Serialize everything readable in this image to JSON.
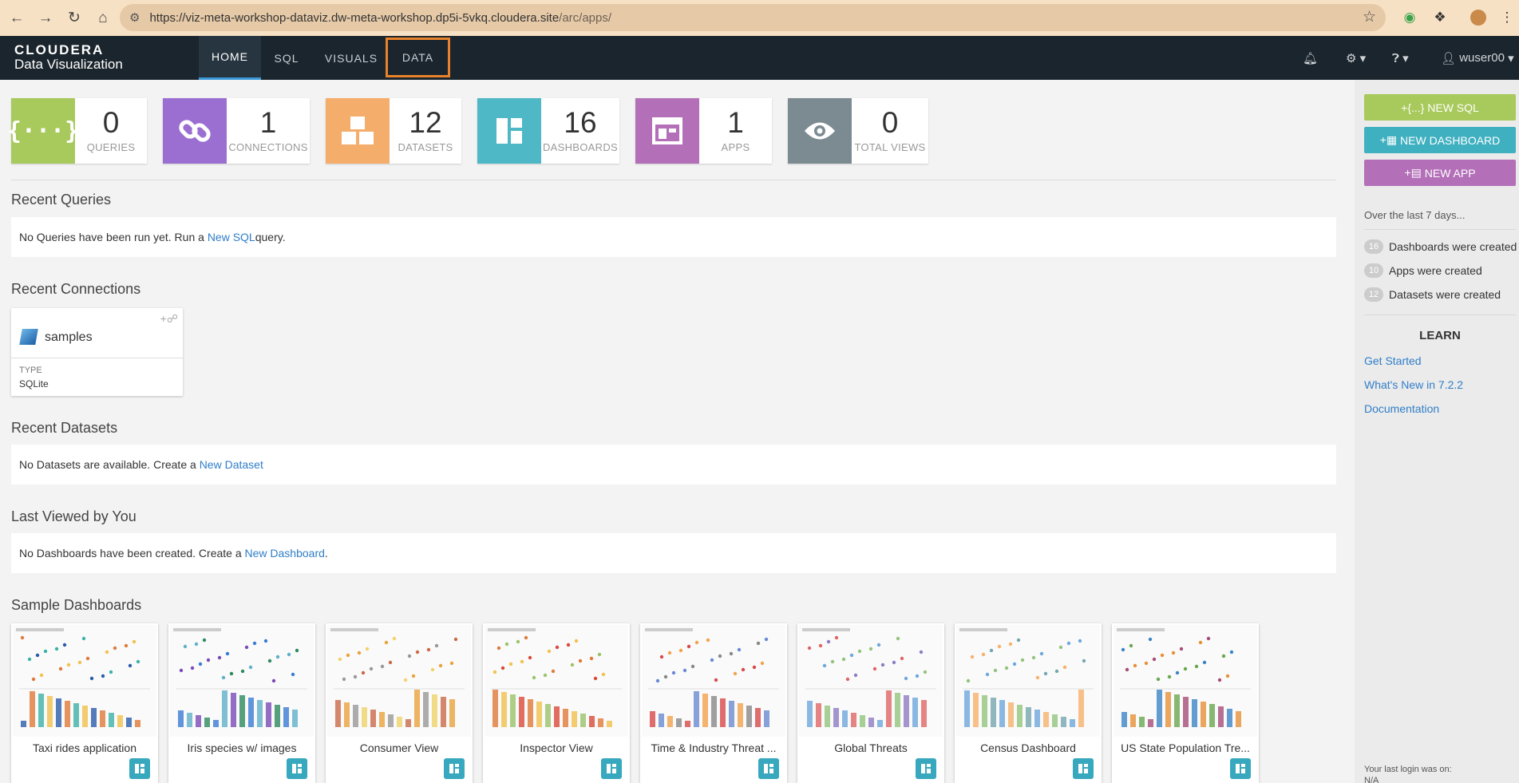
{
  "browser": {
    "url_main": "https://viz-meta-workshop-dataviz.dw-meta-workshop.dp5i-5vkq.cloudera.site",
    "url_path": "/arc/apps/"
  },
  "app": {
    "logo_top": "CLOUDERA",
    "logo_bottom": "Data Visualization"
  },
  "nav": {
    "tabs": [
      "HOME",
      "SQL",
      "VISUALS",
      "DATA"
    ],
    "user": "wuser00"
  },
  "stats": [
    {
      "value": "0",
      "label": "QUERIES",
      "color": "#a8c95b"
    },
    {
      "value": "1",
      "label": "CONNECTIONS",
      "color": "#9b6fd1"
    },
    {
      "value": "12",
      "label": "DATASETS",
      "color": "#f5ad6b"
    },
    {
      "value": "16",
      "label": "DASHBOARDS",
      "color": "#4fb8c6"
    },
    {
      "value": "1",
      "label": "APPS",
      "color": "#b36fb8"
    },
    {
      "value": "0",
      "label": "TOTAL VIEWS",
      "color": "#7c8a92"
    }
  ],
  "sections": {
    "recent_queries": {
      "title": "Recent Queries",
      "msg_pre": "No Queries have been run yet. Run a ",
      "link": "New SQL",
      "msg_post": " query."
    },
    "recent_connections": {
      "title": "Recent Connections"
    },
    "recent_datasets": {
      "title": "Recent Datasets",
      "msg_pre": "No Datasets are available. Create a ",
      "link": "New Dataset"
    },
    "last_viewed": {
      "title": "Last Viewed by You",
      "msg_pre": "No Dashboards have been created. Create a ",
      "link": "New Dashboard",
      "msg_post": "."
    },
    "sample_dashboards": {
      "title": "Sample Dashboards"
    }
  },
  "connection": {
    "name": "samples",
    "type_label": "TYPE",
    "type_value": "SQLite"
  },
  "samples": [
    "Taxi rides application",
    "Iris species w/ images",
    "Consumer View",
    "Inspector View",
    "Time & Industry Threat ...",
    "Global Threats",
    "Census Dashboard",
    "US State Population Tre..."
  ],
  "right": {
    "btn_sql": "NEW SQL",
    "btn_dashboard": "NEW DASHBOARD",
    "btn_app": "NEW APP",
    "over": "Over the last 7 days...",
    "activity": [
      {
        "count": "16",
        "text": "Dashboards were created"
      },
      {
        "count": "10",
        "text": "Apps were created"
      },
      {
        "count": "12",
        "text": "Datasets were created"
      }
    ],
    "learn": "LEARN",
    "links": [
      "Get Started",
      "What's New in 7.2.2",
      "Documentation"
    ],
    "last_login": "Your last login was on:",
    "last_login_value": "N/A"
  }
}
